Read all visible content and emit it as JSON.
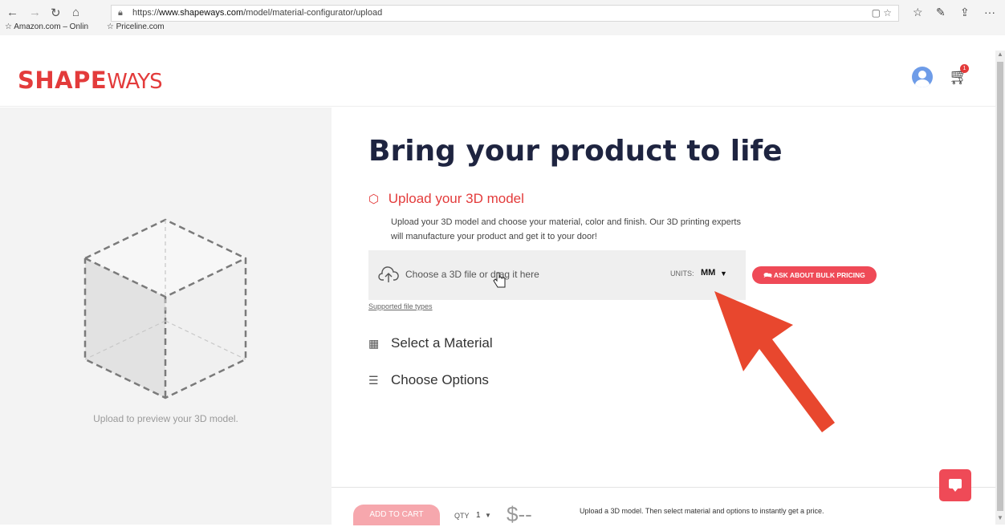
{
  "browser": {
    "url_prefix": "https://",
    "url_domain": "www.shapeways.com",
    "url_path": "/model/material-configurator/upload",
    "favorites": [
      "Amazon.com – Onlin",
      "Priceline.com"
    ]
  },
  "header": {
    "logo_bold": "SHAPE",
    "logo_light": "WAYS",
    "cart_count": "1"
  },
  "preview": {
    "text": "Upload to preview your 3D model."
  },
  "main": {
    "title": "Bring your product to life",
    "upload_step": "Upload your 3D model",
    "description": "Upload your 3D model and choose your material, color and finish. Our 3D printing experts will manufacture your product and get it to your door!",
    "dropzone_text": "Choose a 3D file or drag it here",
    "units_label": "UNITS:",
    "units_value": "MM",
    "bulk_button": "ASK ABOUT BULK PRICING",
    "supported_link": "Supported file types",
    "select_material": "Select a Material",
    "choose_options": "Choose Options"
  },
  "bottom": {
    "add_to_cart": "ADD TO CART",
    "qty_label": "QTY",
    "qty_value": "1",
    "price": "$--",
    "price_note": "Upload a 3D model. Then select material and options to instantly get a price."
  },
  "colors": {
    "brand": "#e33b3b",
    "button": "#ef4a57",
    "annotation_arrow": "#e8472e",
    "dark_title": "#1e2440"
  }
}
